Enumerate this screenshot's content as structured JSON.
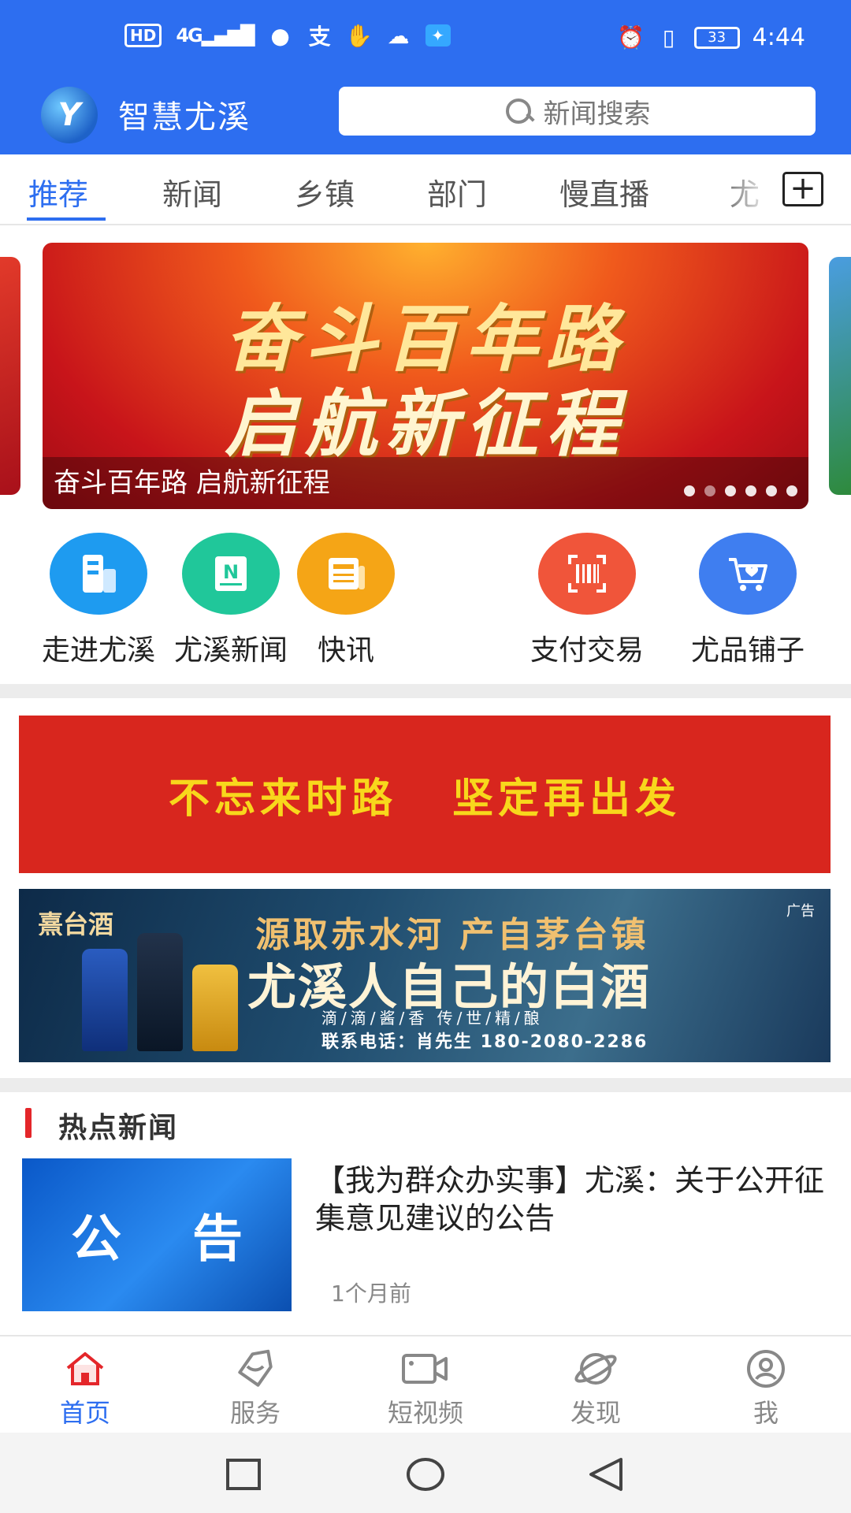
{
  "status_bar": {
    "hd": "HD",
    "network": "4G",
    "battery": "33",
    "time": "4:44"
  },
  "app": {
    "title": "智慧尤溪",
    "search_placeholder": "新闻搜索"
  },
  "tabs": [
    "推荐",
    "新闻",
    "乡镇",
    "部门",
    "慢直播",
    "尤"
  ],
  "banner": {
    "line1": "奋斗百年路",
    "line2": "启航新征程",
    "caption": "奋斗百年路 启航新征程",
    "dot_count": 6
  },
  "quick_entries": [
    {
      "label": "走进尤溪",
      "icon": "building-icon",
      "color": "#1e9bf0"
    },
    {
      "label": "尤溪新闻",
      "icon": "news-icon",
      "color": "#20c79a"
    },
    {
      "label": "快讯",
      "icon": "newspaper-icon",
      "color": "#f5a516"
    },
    {
      "label": "支付交易",
      "icon": "barcode-icon",
      "color": "#f0553a"
    },
    {
      "label": "尤品铺子",
      "icon": "cart-icon",
      "color": "#3f7ef0"
    }
  ],
  "slogan": {
    "part1": "不忘来时路",
    "part2": "坚定再出发"
  },
  "ad": {
    "brand": "熹台酒",
    "line1": "源取赤水河  产自茅台镇",
    "line2": "尤溪人自己的白酒",
    "line3": "滴/滴/酱/香   传/世/精/酿",
    "line4": "联系电话：肖先生 180-2080-2286",
    "tag": "广告"
  },
  "hot_news": {
    "section_title": "热点新闻",
    "items": [
      {
        "thumb_left": "公",
        "thumb_right": "告",
        "title": "【我为群众办实事】尤溪：关于公开征集意见建议的公告",
        "time": "1个月前"
      }
    ]
  },
  "bottom_nav": [
    {
      "label": "首页",
      "icon": "home-icon",
      "active": true
    },
    {
      "label": "服务",
      "icon": "service-tag-icon",
      "active": false
    },
    {
      "label": "短视频",
      "icon": "video-camera-icon",
      "active": false
    },
    {
      "label": "发现",
      "icon": "discover-icon",
      "active": false
    },
    {
      "label": "我",
      "icon": "profile-icon",
      "active": false
    }
  ],
  "colors": {
    "brand_blue": "#2d6ef0",
    "slogan_red": "#d8261e",
    "slogan_yellow": "#f8d71c",
    "hot_red": "#e4262a"
  }
}
